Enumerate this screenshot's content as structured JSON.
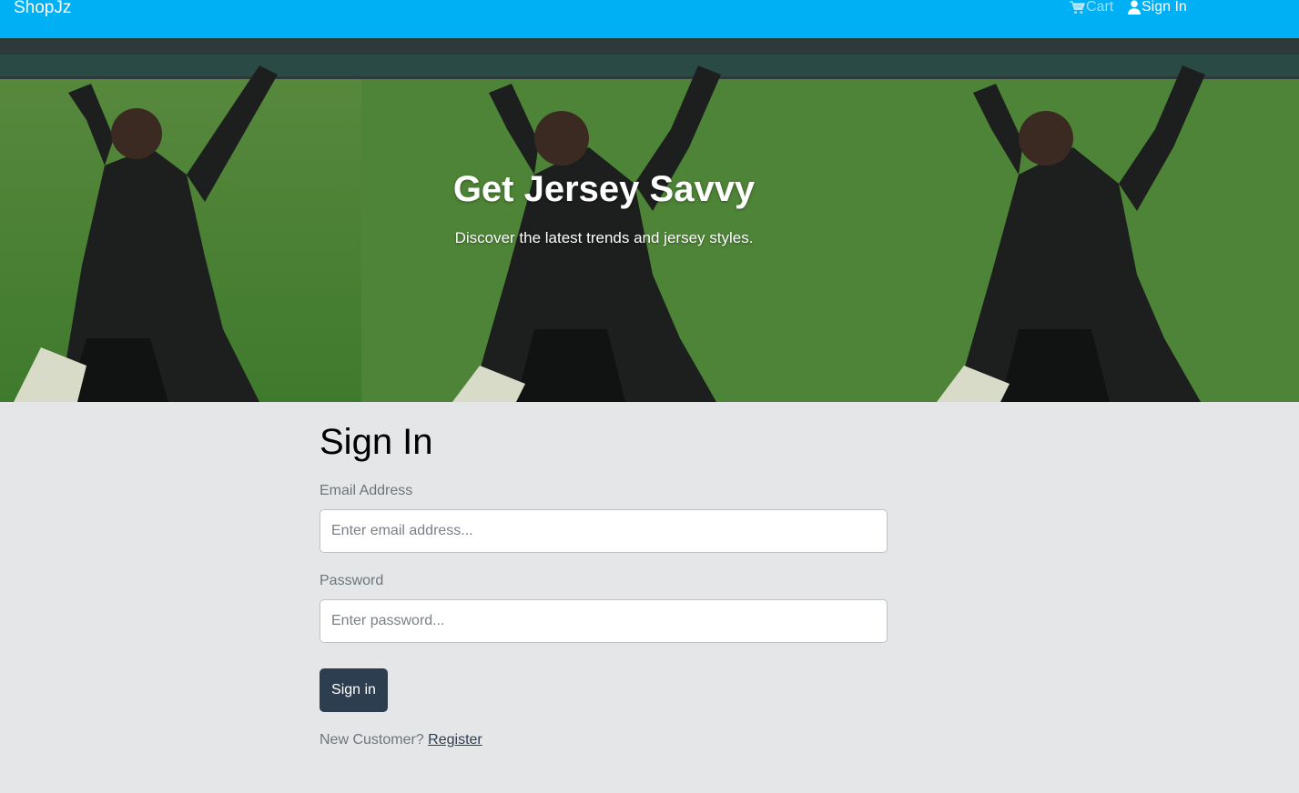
{
  "navbar": {
    "brand": "ShopJz",
    "cart_label": "Cart",
    "signin_label": "Sign In",
    "bg_color": "#00b0f5",
    "cart_icon": "cart-icon",
    "user_icon": "user-icon"
  },
  "hero": {
    "title": "Get Jersey Savvy",
    "subtitle": "Discover the latest trends and jersey styles."
  },
  "signin_form": {
    "heading": "Sign In",
    "email_label": "Email Address",
    "email_placeholder": "Enter email address...",
    "email_value": "",
    "password_label": "Password",
    "password_placeholder": "Enter password...",
    "password_value": "",
    "submit_label": "Sign in",
    "new_customer_text": "New Customer?",
    "register_label": "Register",
    "button_color": "#2c3e50"
  }
}
